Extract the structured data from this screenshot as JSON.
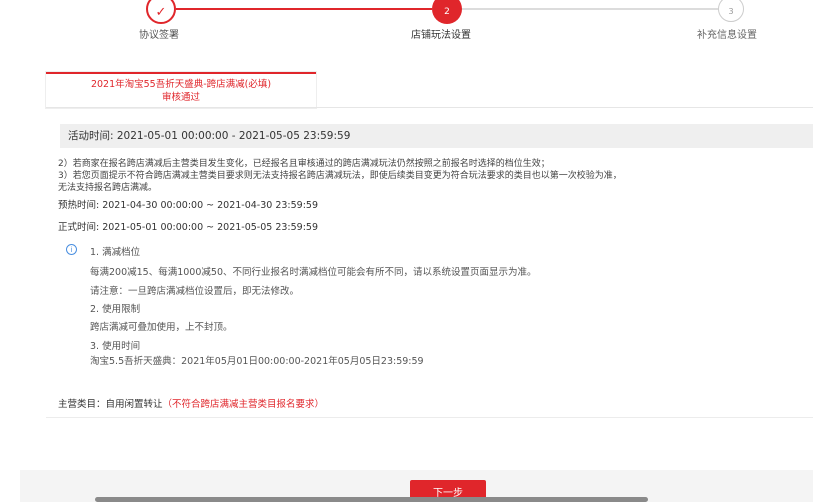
{
  "stepper": {
    "steps": [
      {
        "label": "协议签署",
        "state": "done",
        "icon": "check-icon"
      },
      {
        "label": "店铺玩法设置",
        "state": "active",
        "number": "2"
      },
      {
        "label": "补充信息设置",
        "state": "pending",
        "number": "3"
      }
    ]
  },
  "tab": {
    "title": "2021年淘宝55吾折天盛典-跨店满减(必填)",
    "status": "审核通过"
  },
  "activity_time": "活动时间: 2021-05-01 00:00:00 - 2021-05-05 23:59:59",
  "notes": [
    "2）若商家在报名跨店满减后主营类目发生变化，已经报名且审核通过的跨店满减玩法仍然按照之前报名时选择的档位生效；",
    "3）若您页面提示不符合跨店满减主营类目要求则无法支持报名跨店满减玩法，即使后续类目变更为符合玩法要求的类目也以第一次校验为准，",
    "无法支持报名跨店满减。"
  ],
  "preheat_time": "预热时间: 2021-04-30 00:00:00 ~ 2021-04-30 23:59:59",
  "formal_time": "正式时间: 2021-05-01 00:00:00 ~ 2021-05-05 23:59:59",
  "rules": {
    "info_icon": "i",
    "section1_title": "1. 满减档位",
    "section1_line1": "每满200减15、每满1000减50、不同行业报名时满减档位可能会有所不同，请以系统设置页面显示为准。",
    "section1_line2": "请注意：一旦跨店满减档位设置后，即无法修改。",
    "section2_title": "2. 使用限制",
    "section2_line1": "跨店满减可叠加使用，上不封顶。",
    "section3_title": "3. 使用时间",
    "section3_line1": "淘宝5.5吾折天盛典：2021年05月01日00:00:00-2021年05月05日23:59:59"
  },
  "category": {
    "label": "主营类目：自用闲置转让",
    "warning": "（不符合跨店满减主营类目报名要求）",
    "warning_color": "#e0262b"
  },
  "footer": {
    "next_label": "下一步"
  },
  "colors": {
    "accent": "#e0262b",
    "info": "#4a8fe0"
  }
}
